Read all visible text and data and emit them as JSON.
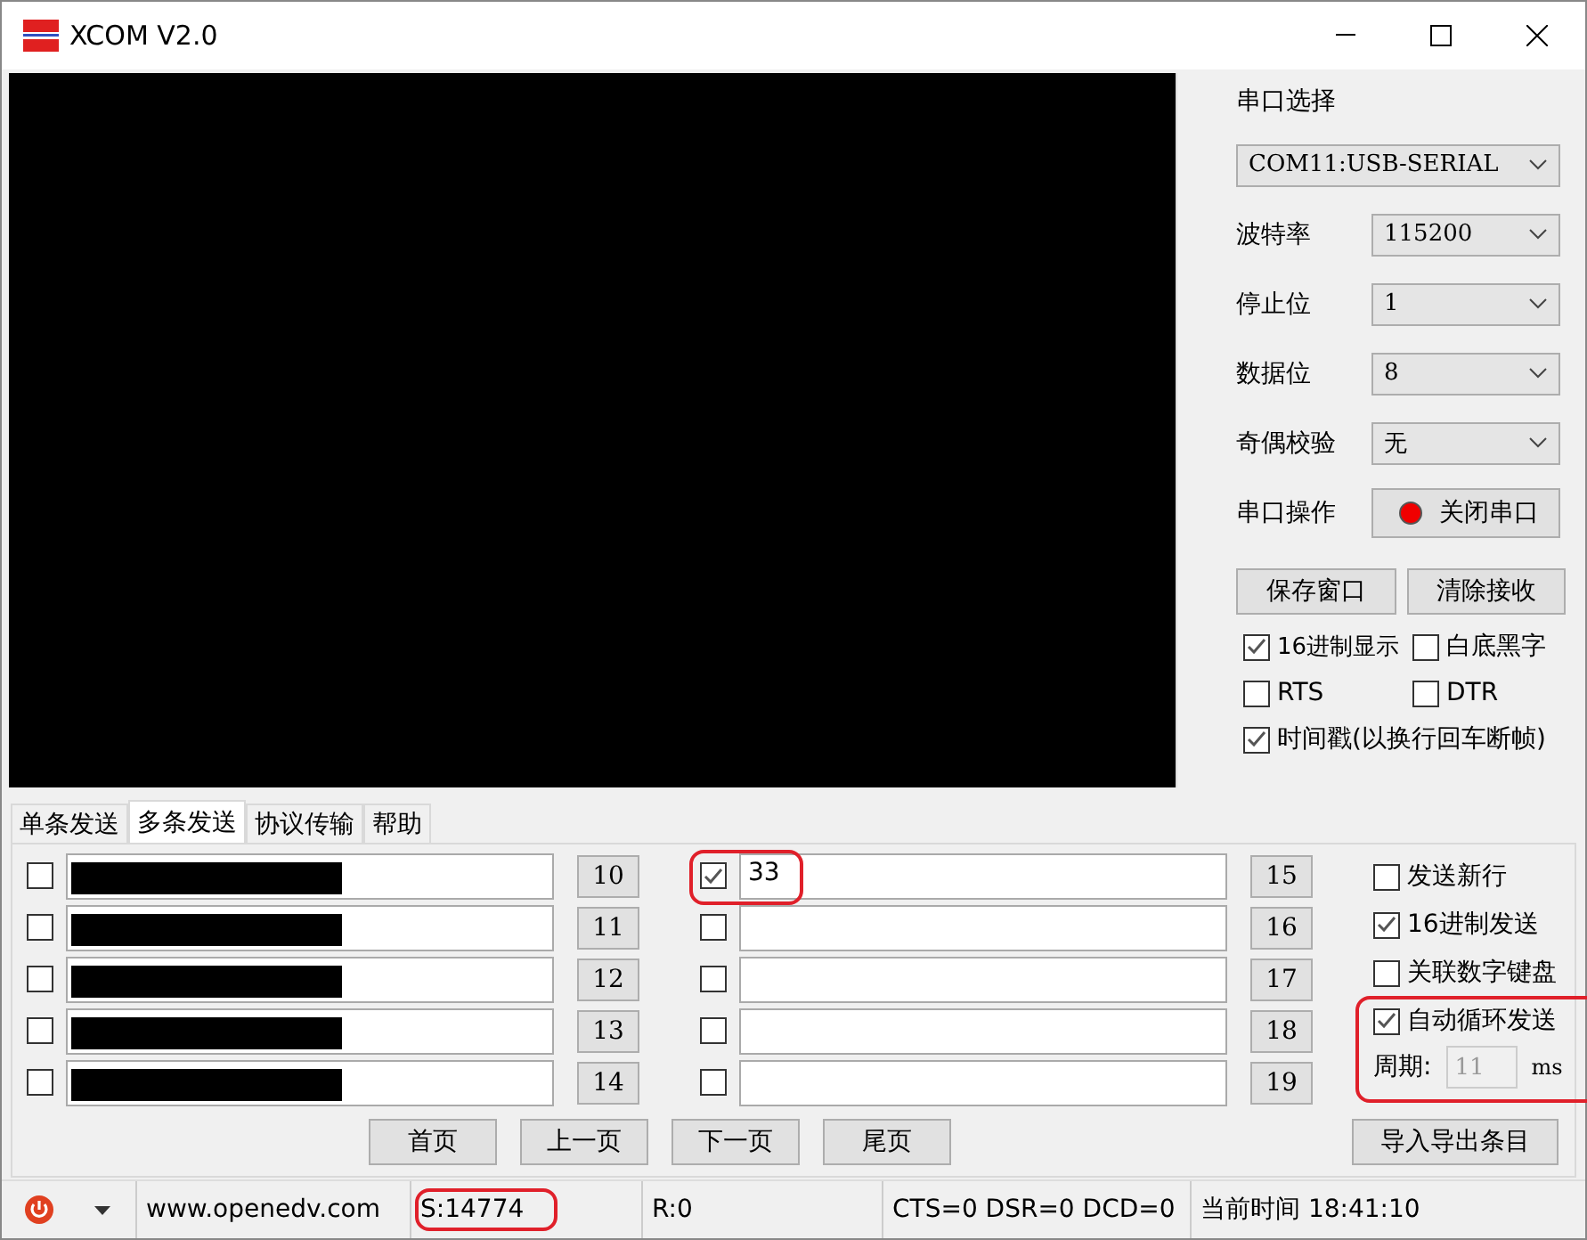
{
  "window": {
    "title": "XCOM V2.0"
  },
  "port": {
    "title": "串口选择",
    "value": "COM11:USB-SERIAL"
  },
  "settings": [
    {
      "label": "波特率",
      "value": "115200"
    },
    {
      "label": "停止位",
      "value": "1"
    },
    {
      "label": "数据位",
      "value": "8"
    },
    {
      "label": "奇偶校验",
      "value": "无"
    }
  ],
  "port_operation": {
    "label": "串口操作",
    "button": "关闭串口",
    "open": true
  },
  "receive_buttons": [
    "保存窗口",
    "清除接收"
  ],
  "receive_options": [
    {
      "label": "16进制显示",
      "checked": true
    },
    {
      "label": "白底黑字",
      "checked": false
    },
    {
      "label": "RTS",
      "checked": false
    },
    {
      "label": "DTR",
      "checked": false
    },
    {
      "label": "时间戳(以换行回车断帧)",
      "checked": true
    }
  ],
  "tabs": [
    {
      "label": "单条发送",
      "selected": false
    },
    {
      "label": "多条发送",
      "selected": true
    },
    {
      "label": "协议传输",
      "selected": false
    },
    {
      "label": "帮助",
      "selected": false
    }
  ],
  "entries_left": [
    {
      "number": "10",
      "checked": false,
      "redacted": true
    },
    {
      "number": "11",
      "checked": false,
      "redacted": true
    },
    {
      "number": "12",
      "checked": false,
      "redacted": true
    },
    {
      "number": "13",
      "checked": false,
      "redacted": true
    },
    {
      "number": "14",
      "checked": false,
      "redacted": true
    }
  ],
  "entries_right": [
    {
      "number": "15",
      "checked": true,
      "value": "33",
      "highlighted": true
    },
    {
      "number": "16",
      "checked": false
    },
    {
      "number": "17",
      "checked": false
    },
    {
      "number": "18",
      "checked": false
    },
    {
      "number": "19",
      "checked": false
    }
  ],
  "send_options": [
    {
      "label": "发送新行",
      "checked": false
    },
    {
      "label": "16进制发送",
      "checked": true
    },
    {
      "label": "关联数字键盘",
      "checked": false
    }
  ],
  "auto_send": {
    "label": "自动循环发送",
    "checked": true,
    "period_label": "周期:",
    "period": "11",
    "unit": "ms",
    "highlighted": true
  },
  "page_buttons": [
    "首页",
    "上一页",
    "下一页",
    "尾页"
  ],
  "import_button": "导入导出条目",
  "status_bar": {
    "url": "www.openedv.com",
    "sent": "S:14774",
    "sent_highlighted": true,
    "received": "R:0",
    "lines": "CTS=0 DSR=0 DCD=0",
    "time": "当前时间 18:41:10"
  }
}
